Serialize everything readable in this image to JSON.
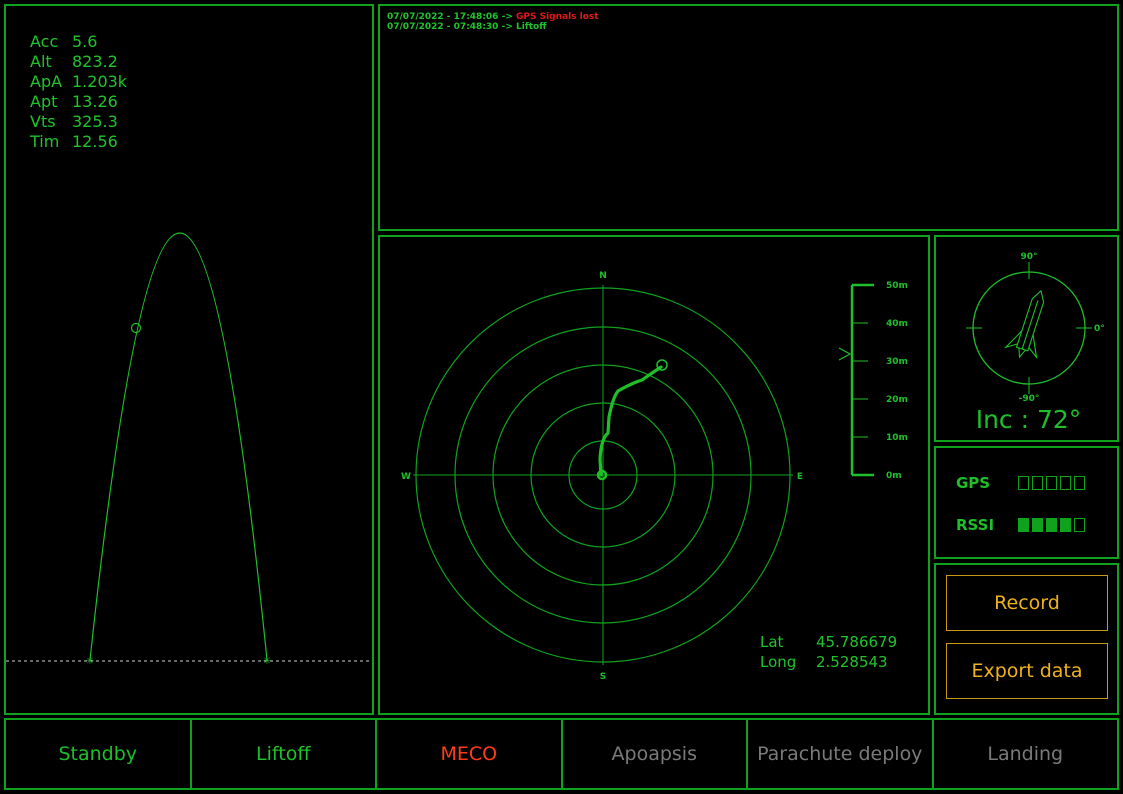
{
  "telemetry": [
    {
      "key": "Acc",
      "value": "5.6"
    },
    {
      "key": "Alt",
      "value": "823.2"
    },
    {
      "key": "ApA",
      "value": "1.203k"
    },
    {
      "key": "Apt",
      "value": "13.26"
    },
    {
      "key": "Vts",
      "value": "325.3"
    },
    {
      "key": "Tim",
      "value": "12.56"
    }
  ],
  "log": [
    {
      "prefix": "07/07/2022 - 17:48:06 -> ",
      "message": "GPS Signals lost",
      "level": "error"
    },
    {
      "prefix": "07/07/2022 - 07:48:30 -> ",
      "message": "Liftoff",
      "level": "info"
    }
  ],
  "radar": {
    "north": "N",
    "south": "S",
    "east": "E",
    "west": "W",
    "scale": [
      "50m",
      "40m",
      "30m",
      "20m",
      "10m",
      "0m"
    ],
    "scale_pointer": "30m"
  },
  "coords": {
    "lat_label": "Lat",
    "lat_value": "45.786679",
    "long_label": "Long",
    "long_value": "2.528543"
  },
  "inclination": {
    "label": "Inc : 72°",
    "value_deg": 72,
    "top_label": "90°",
    "right_label": "0°",
    "bottom_label": "-90°"
  },
  "signal": {
    "gps_label": "GPS",
    "gps_level": 0,
    "rssi_label": "RSSI",
    "rssi_level": 4,
    "bars_total": 5
  },
  "buttons": {
    "record": "Record",
    "export": "Export data"
  },
  "phases": [
    {
      "label": "Standby",
      "state": "done"
    },
    {
      "label": "Liftoff",
      "state": "done"
    },
    {
      "label": "MECO",
      "state": "active"
    },
    {
      "label": "Apoapsis",
      "state": "pending"
    },
    {
      "label": "Parachute deploy",
      "state": "pending"
    },
    {
      "label": "Landing",
      "state": "pending"
    }
  ],
  "colors": {
    "green": "#1fbf2a",
    "error": "#e01818",
    "active": "#ff3b1a",
    "pending": "#7a7a7a",
    "button": "#f0b21a"
  }
}
